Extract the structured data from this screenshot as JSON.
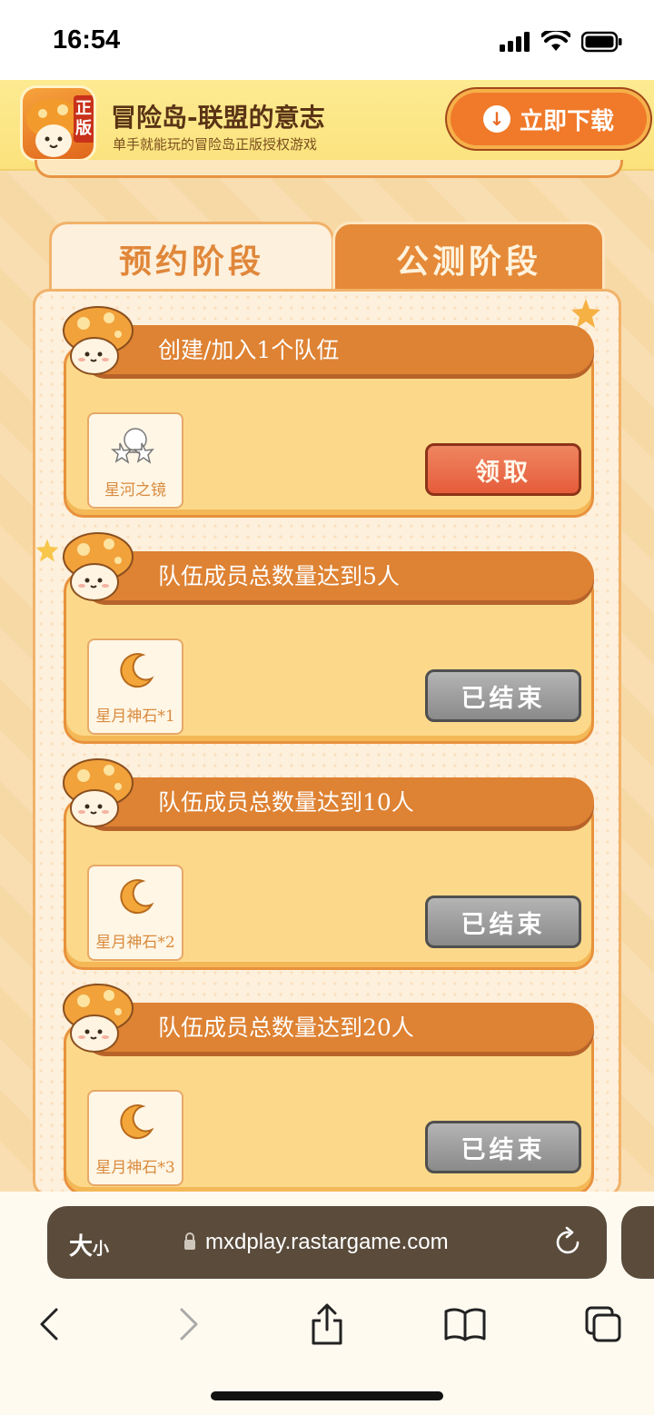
{
  "status_bar": {
    "time": "16:54"
  },
  "app_banner": {
    "title": "冒险岛-联盟的意志",
    "subtitle": "单手就能玩的冒险岛正版授权游戏",
    "download_label": "立即下载",
    "logo_text": "正版"
  },
  "tabs": [
    {
      "label": "预约阶段",
      "active": true
    },
    {
      "label": "公测阶段",
      "active": false
    }
  ],
  "tasks": [
    {
      "title": "创建/加入1个队伍",
      "reward_label": "星河之镜",
      "reward_icon": "star-glasses-icon",
      "button_label": "领取",
      "button_state": "claim"
    },
    {
      "title": "队伍成员总数量达到5人",
      "reward_label": "星月神石*1",
      "reward_icon": "crescent-moon-icon",
      "button_label": "已结束",
      "button_state": "ended"
    },
    {
      "title": "队伍成员总数量达到10人",
      "reward_label": "星月神石*2",
      "reward_icon": "crescent-moon-icon",
      "button_label": "已结束",
      "button_state": "ended"
    },
    {
      "title": "队伍成员总数量达到20人",
      "reward_label": "星月神石*3",
      "reward_icon": "crescent-moon-icon",
      "button_label": "已结束",
      "button_state": "ended"
    }
  ],
  "browser": {
    "text_size_label": "大",
    "text_size_small": "小",
    "url": "mxdplay.rastargame.com"
  },
  "colors": {
    "accent": "#de8233",
    "claim_button": "#e65c3a",
    "ended_button": "#8a8a8a",
    "panel": "#fdf0dc"
  }
}
